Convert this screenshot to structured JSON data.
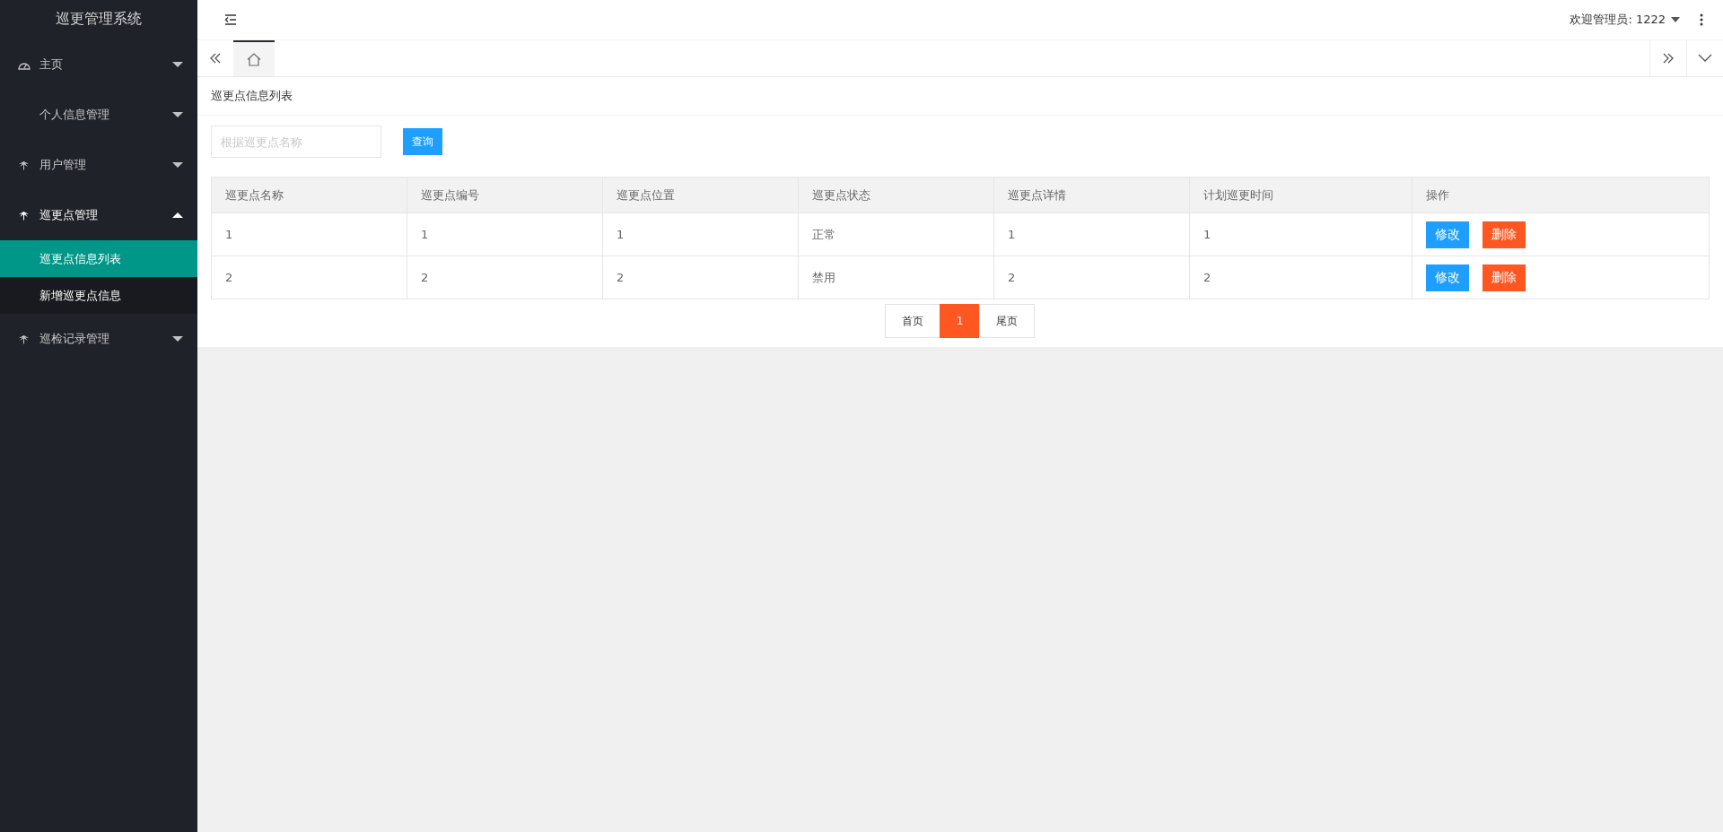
{
  "sidebar": {
    "title": "巡更管理系统",
    "items": [
      {
        "label": "主页",
        "kind": "gauge",
        "expanded": false
      },
      {
        "label": "个人信息管理",
        "kind": "plain",
        "expanded": false
      },
      {
        "label": "用户管理",
        "kind": "leaf",
        "expanded": false
      },
      {
        "label": "巡更点管理",
        "kind": "leaf",
        "expanded": true,
        "children": [
          {
            "label": "巡更点信息列表",
            "selected": true
          },
          {
            "label": "新增巡更点信息",
            "selected": false
          }
        ]
      },
      {
        "label": "巡检记录管理",
        "kind": "leaf",
        "expanded": false
      }
    ]
  },
  "header": {
    "user": "欢迎管理员: 1222"
  },
  "tabs": [
    {
      "kind": "home",
      "selected": true
    }
  ],
  "page_title": "巡更点信息列表",
  "search": {
    "placeholder": "根据巡更点名称",
    "button": "查询"
  },
  "table": {
    "columns": [
      "巡更点名称",
      "巡更点编号",
      "巡更点位置",
      "巡更点状态",
      "巡更点详情",
      "计划巡更时间",
      "操作"
    ],
    "rows": [
      {
        "cells": [
          "1",
          "1",
          "1",
          "正常",
          "1",
          "1"
        ],
        "actions": [
          "修改",
          "删除"
        ]
      },
      {
        "cells": [
          "2",
          "2",
          "2",
          "禁用",
          "2",
          "2"
        ],
        "actions": [
          "修改",
          "删除"
        ]
      }
    ]
  },
  "pagination": [
    {
      "label": "首页",
      "selected": false
    },
    {
      "label": "1",
      "selected": true
    },
    {
      "label": "尾页",
      "selected": false
    }
  ]
}
